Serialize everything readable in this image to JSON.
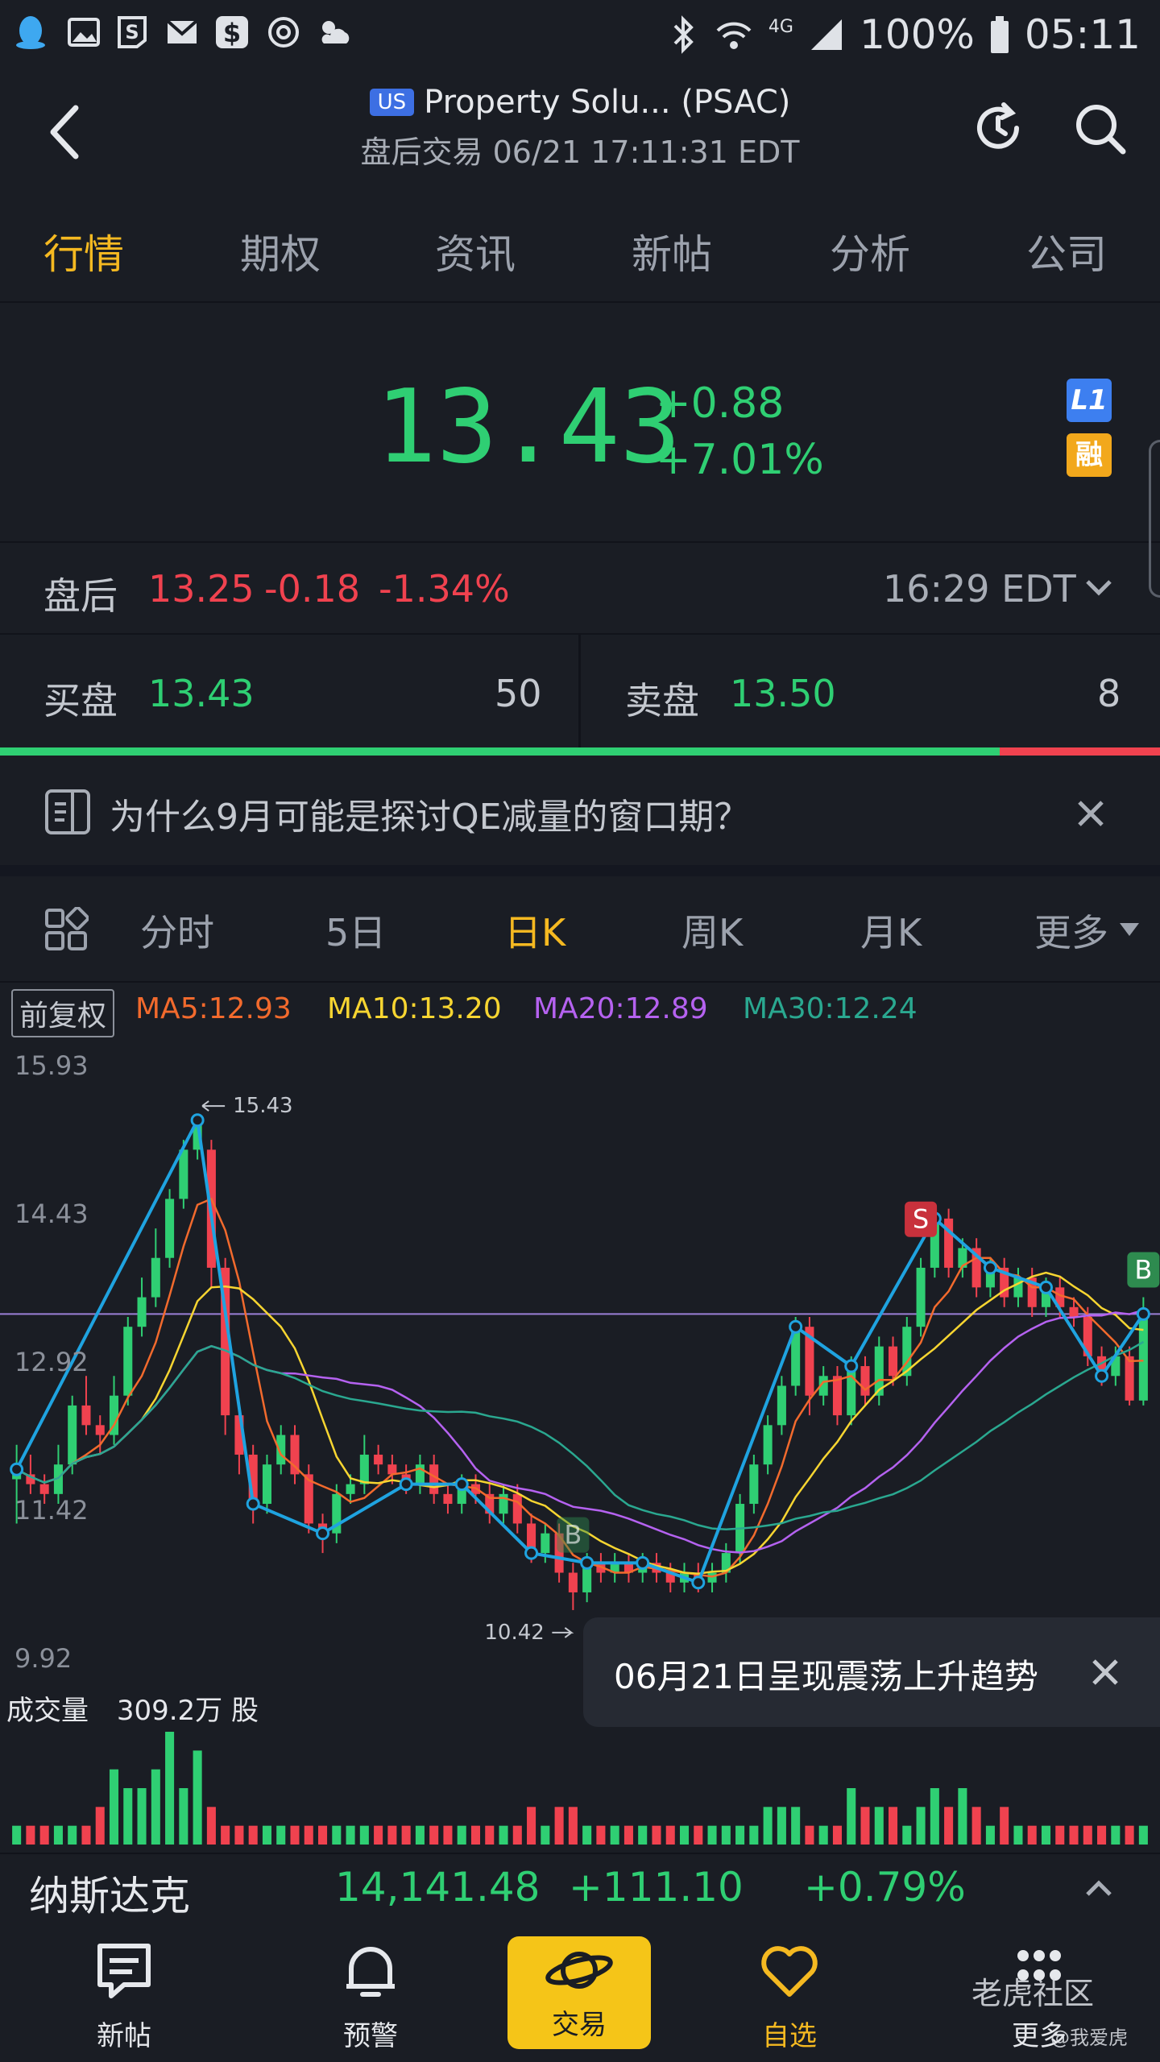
{
  "status_bar": {
    "battery": "100%",
    "time": "05:11",
    "network": "4G",
    "left_icons": [
      "qq-icon",
      "gallery-icon",
      "s-app-icon",
      "mail-icon",
      "dollar-app-icon",
      "sync-icon",
      "weather-icon"
    ]
  },
  "header": {
    "market_badge": "US",
    "title": "Property Solu... (PSAC)",
    "subtitle": "盘后交易 06/21 17:11:31 EDT"
  },
  "tabs": [
    {
      "label": "行情",
      "active": true
    },
    {
      "label": "期权",
      "active": false
    },
    {
      "label": "资讯",
      "active": false
    },
    {
      "label": "新帖",
      "active": false
    },
    {
      "label": "分析",
      "active": false
    },
    {
      "label": "公司",
      "active": false
    }
  ],
  "quote": {
    "price": "13.43",
    "change": "+0.88",
    "change_pct": "+7.01%",
    "badge_l1": "L1",
    "badge_margin": "融",
    "color_up": "#2fcf73",
    "color_down": "#f0424f"
  },
  "after_hours": {
    "label": "盘后",
    "price": "13.25",
    "change": "-0.18",
    "change_pct": "-1.34%",
    "time": "16:29 EDT"
  },
  "bid": {
    "label": "买盘",
    "price": "13.43",
    "size": "50"
  },
  "ask": {
    "label": "卖盘",
    "price": "13.50",
    "size": "8"
  },
  "bid_ask_ratio": 0.862,
  "news_banner": {
    "text": "为什么9月可能是探讨QE减量的窗口期？"
  },
  "period_tabs": [
    {
      "label": "分时",
      "active": false
    },
    {
      "label": "5日",
      "active": false
    },
    {
      "label": "日K",
      "active": true
    },
    {
      "label": "周K",
      "active": false
    },
    {
      "label": "月K",
      "active": false
    },
    {
      "label": "更多",
      "active": false
    }
  ],
  "ma": {
    "adjust_label": "前复权",
    "ma5": "MA5:12.93",
    "ma10": "MA10:13.20",
    "ma20": "MA20:12.89",
    "ma30": "MA30:12.24",
    "ma5_color": "#f26a2d",
    "ma10_color": "#f7d531",
    "ma20_color": "#b562f0",
    "ma30_color": "#2aa890"
  },
  "chart_data": {
    "type": "candlestick",
    "y_ticks": [
      "15.93",
      "14.43",
      "12.92",
      "11.42",
      "9.92"
    ],
    "ylim": [
      9.92,
      15.93
    ],
    "high_marker": "15.43",
    "low_marker": "10.42",
    "signals": [
      "S",
      "B",
      "B"
    ],
    "candles": [
      {
        "o": 11.75,
        "c": 11.85,
        "h": 12.1,
        "l": 11.3
      },
      {
        "o": 11.8,
        "c": 11.7,
        "h": 12.0,
        "l": 11.6
      },
      {
        "o": 11.7,
        "c": 11.6,
        "h": 11.8,
        "l": 11.5
      },
      {
        "o": 11.6,
        "c": 11.9,
        "h": 12.1,
        "l": 11.5
      },
      {
        "o": 11.9,
        "c": 12.5,
        "h": 12.6,
        "l": 11.8
      },
      {
        "o": 12.5,
        "c": 12.3,
        "h": 12.8,
        "l": 12.2
      },
      {
        "o": 12.3,
        "c": 12.2,
        "h": 12.4,
        "l": 12.0
      },
      {
        "o": 12.2,
        "c": 12.6,
        "h": 12.8,
        "l": 12.1
      },
      {
        "o": 12.6,
        "c": 13.3,
        "h": 13.4,
        "l": 12.5
      },
      {
        "o": 13.3,
        "c": 13.6,
        "h": 13.8,
        "l": 13.2
      },
      {
        "o": 13.6,
        "c": 14.0,
        "h": 14.3,
        "l": 13.5
      },
      {
        "o": 14.0,
        "c": 14.6,
        "h": 14.7,
        "l": 13.9
      },
      {
        "o": 14.6,
        "c": 15.1,
        "h": 15.2,
        "l": 14.5
      },
      {
        "o": 15.1,
        "c": 15.4,
        "h": 15.43,
        "l": 15.0
      },
      {
        "o": 15.1,
        "c": 13.9,
        "h": 15.2,
        "l": 13.7
      },
      {
        "o": 13.9,
        "c": 12.4,
        "h": 14.0,
        "l": 12.2
      },
      {
        "o": 12.4,
        "c": 12.0,
        "h": 12.5,
        "l": 11.8
      },
      {
        "o": 12.0,
        "c": 11.5,
        "h": 12.1,
        "l": 11.3
      },
      {
        "o": 11.5,
        "c": 11.9,
        "h": 12.0,
        "l": 11.4
      },
      {
        "o": 11.9,
        "c": 12.2,
        "h": 12.3,
        "l": 11.8
      },
      {
        "o": 12.2,
        "c": 11.8,
        "h": 12.3,
        "l": 11.7
      },
      {
        "o": 11.8,
        "c": 11.3,
        "h": 11.9,
        "l": 11.2
      },
      {
        "o": 11.3,
        "c": 11.2,
        "h": 11.4,
        "l": 11.0
      },
      {
        "o": 11.2,
        "c": 11.6,
        "h": 11.7,
        "l": 11.1
      },
      {
        "o": 11.6,
        "c": 11.7,
        "h": 11.8,
        "l": 11.5
      },
      {
        "o": 11.7,
        "c": 12.0,
        "h": 12.2,
        "l": 11.6
      },
      {
        "o": 12.0,
        "c": 11.9,
        "h": 12.1,
        "l": 11.8
      },
      {
        "o": 11.9,
        "c": 11.8,
        "h": 12.0,
        "l": 11.7
      },
      {
        "o": 11.8,
        "c": 11.7,
        "h": 11.9,
        "l": 11.6
      },
      {
        "o": 11.7,
        "c": 11.9,
        "h": 12.0,
        "l": 11.6
      },
      {
        "o": 11.9,
        "c": 11.6,
        "h": 12.0,
        "l": 11.5
      },
      {
        "o": 11.6,
        "c": 11.5,
        "h": 11.7,
        "l": 11.4
      },
      {
        "o": 11.5,
        "c": 11.7,
        "h": 11.8,
        "l": 11.4
      },
      {
        "o": 11.7,
        "c": 11.6,
        "h": 11.8,
        "l": 11.5
      },
      {
        "o": 11.6,
        "c": 11.4,
        "h": 11.7,
        "l": 11.3
      },
      {
        "o": 11.4,
        "c": 11.6,
        "h": 11.7,
        "l": 11.3
      },
      {
        "o": 11.6,
        "c": 11.3,
        "h": 11.7,
        "l": 11.2
      },
      {
        "o": 11.3,
        "c": 11.0,
        "h": 11.4,
        "l": 10.9
      },
      {
        "o": 11.0,
        "c": 11.2,
        "h": 11.3,
        "l": 10.9
      },
      {
        "o": 11.2,
        "c": 10.8,
        "h": 11.3,
        "l": 10.7
      },
      {
        "o": 10.8,
        "c": 10.6,
        "h": 10.9,
        "l": 10.42
      },
      {
        "o": 10.6,
        "c": 10.9,
        "h": 11.0,
        "l": 10.5
      },
      {
        "o": 10.9,
        "c": 10.8,
        "h": 11.0,
        "l": 10.7
      },
      {
        "o": 10.8,
        "c": 10.9,
        "h": 11.0,
        "l": 10.7
      },
      {
        "o": 10.9,
        "c": 10.8,
        "h": 11.0,
        "l": 10.7
      },
      {
        "o": 10.8,
        "c": 10.9,
        "h": 11.0,
        "l": 10.7
      },
      {
        "o": 10.9,
        "c": 10.8,
        "h": 11.0,
        "l": 10.7
      },
      {
        "o": 10.8,
        "c": 10.7,
        "h": 10.9,
        "l": 10.6
      },
      {
        "o": 10.7,
        "c": 10.8,
        "h": 10.9,
        "l": 10.6
      },
      {
        "o": 10.8,
        "c": 10.7,
        "h": 10.9,
        "l": 10.6
      },
      {
        "o": 10.7,
        "c": 10.8,
        "h": 10.9,
        "l": 10.6
      },
      {
        "o": 10.8,
        "c": 11.0,
        "h": 11.1,
        "l": 10.7
      },
      {
        "o": 11.0,
        "c": 11.5,
        "h": 11.6,
        "l": 10.9
      },
      {
        "o": 11.5,
        "c": 11.9,
        "h": 12.0,
        "l": 11.4
      },
      {
        "o": 11.9,
        "c": 12.3,
        "h": 12.4,
        "l": 11.8
      },
      {
        "o": 12.3,
        "c": 12.7,
        "h": 12.8,
        "l": 12.2
      },
      {
        "o": 12.7,
        "c": 13.3,
        "h": 13.4,
        "l": 12.6
      },
      {
        "o": 13.3,
        "c": 12.6,
        "h": 13.4,
        "l": 12.4
      },
      {
        "o": 12.6,
        "c": 12.8,
        "h": 12.9,
        "l": 12.5
      },
      {
        "o": 12.8,
        "c": 12.4,
        "h": 12.9,
        "l": 12.3
      },
      {
        "o": 12.4,
        "c": 12.9,
        "h": 13.0,
        "l": 12.3
      },
      {
        "o": 12.9,
        "c": 12.6,
        "h": 13.0,
        "l": 12.5
      },
      {
        "o": 12.6,
        "c": 13.1,
        "h": 13.2,
        "l": 12.5
      },
      {
        "o": 13.1,
        "c": 12.8,
        "h": 13.2,
        "l": 12.7
      },
      {
        "o": 12.8,
        "c": 13.3,
        "h": 13.4,
        "l": 12.7
      },
      {
        "o": 13.3,
        "c": 13.9,
        "h": 14.0,
        "l": 13.2
      },
      {
        "o": 13.9,
        "c": 14.4,
        "h": 14.5,
        "l": 13.8
      },
      {
        "o": 14.4,
        "c": 13.9,
        "h": 14.5,
        "l": 13.8
      },
      {
        "o": 13.9,
        "c": 14.1,
        "h": 14.2,
        "l": 13.8
      },
      {
        "o": 14.1,
        "c": 13.7,
        "h": 14.2,
        "l": 13.6
      },
      {
        "o": 13.7,
        "c": 13.9,
        "h": 14.0,
        "l": 13.6
      },
      {
        "o": 13.9,
        "c": 13.6,
        "h": 14.0,
        "l": 13.5
      },
      {
        "o": 13.6,
        "c": 13.8,
        "h": 13.9,
        "l": 13.5
      },
      {
        "o": 13.8,
        "c": 13.5,
        "h": 13.9,
        "l": 13.4
      },
      {
        "o": 13.5,
        "c": 13.7,
        "h": 13.8,
        "l": 13.4
      },
      {
        "o": 13.7,
        "c": 13.5,
        "h": 13.8,
        "l": 13.4
      },
      {
        "o": 13.5,
        "c": 13.4,
        "h": 13.6,
        "l": 13.3
      },
      {
        "o": 13.4,
        "c": 13.0,
        "h": 13.5,
        "l": 12.9
      },
      {
        "o": 13.0,
        "c": 12.8,
        "h": 13.1,
        "l": 12.7
      },
      {
        "o": 12.8,
        "c": 13.0,
        "h": 13.1,
        "l": 12.7
      },
      {
        "o": 13.0,
        "c": 12.55,
        "h": 13.1,
        "l": 12.5
      },
      {
        "o": 12.55,
        "c": 13.43,
        "h": 13.6,
        "l": 12.5
      }
    ],
    "volume_label": "成交量",
    "volume_value": "309.2万 股",
    "volume": [
      1,
      1,
      1,
      1,
      1,
      1,
      2,
      4,
      3,
      3,
      4,
      6,
      3,
      5,
      2,
      1,
      1,
      1,
      1,
      1,
      1,
      1,
      1,
      1,
      1,
      1,
      1,
      1,
      1,
      1,
      1,
      1,
      1,
      1,
      1,
      1,
      1,
      2,
      1,
      2,
      2,
      1,
      1,
      1,
      1,
      1,
      1,
      1,
      1,
      1,
      1,
      1,
      1,
      1,
      2,
      2,
      2,
      1,
      1,
      1,
      3,
      2,
      2,
      2,
      1,
      2,
      3,
      2,
      3,
      2,
      1,
      2,
      1,
      1,
      1,
      1,
      1,
      1,
      1,
      1,
      1,
      1,
      2
    ]
  },
  "trend_popup": {
    "text": "06月21日呈现震荡上升趋势"
  },
  "index": {
    "name": "纳斯达克",
    "value": "14,141.48",
    "change": "+111.10",
    "change_pct": "+0.79%"
  },
  "bottom_nav": [
    {
      "label": "新帖",
      "icon": "post-icon"
    },
    {
      "label": "预警",
      "icon": "bell-icon"
    },
    {
      "label": "交易",
      "icon": "planet-icon"
    },
    {
      "label": "自选",
      "icon": "heart-icon"
    },
    {
      "label": "更多",
      "icon": "more-icon"
    }
  ],
  "watermark": {
    "text": "老虎社区",
    "sub": "@我爱虎"
  }
}
